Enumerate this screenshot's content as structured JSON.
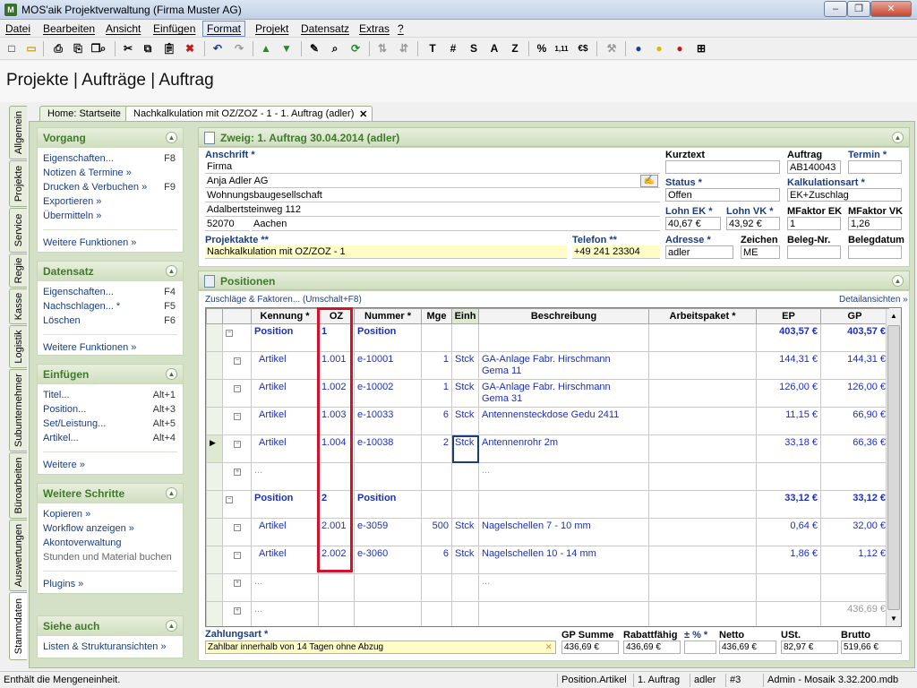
{
  "window": {
    "title": "MOS'aik Projektverwaltung (Firma Muster AG)",
    "min": "–",
    "max": "❐",
    "close": "✕"
  },
  "menu": [
    "Datei",
    "Bearbeiten",
    "Ansicht",
    "Einfügen",
    "Format",
    "Projekt",
    "Datensatz",
    "Extras",
    "?"
  ],
  "toolbar": [
    "new-icon",
    "open-icon",
    "print-icon",
    "print-preview-icon",
    "copy-doc-icon",
    "find-doc-icon",
    "cut-icon",
    "copy-icon",
    "paste-icon",
    "delete-icon",
    "undo-icon",
    "redo-icon",
    "arrow-up-icon",
    "arrow-down-icon",
    "edit-icon",
    "search-icon",
    "refresh-icon",
    "sort-asc-icon",
    "sort-desc-icon",
    "T",
    "#",
    "S",
    "A",
    "Z",
    "%",
    "1,11",
    "€$",
    "tool-icon",
    "user-blue-icon",
    "user-yellow-icon",
    "user-red-icon",
    "layout-icon"
  ],
  "breadcrumb": "Projekte | Aufträge | Auftrag",
  "vtabs": [
    "Allgemein",
    "Projekte",
    "Service",
    "Regie",
    "Kasse",
    "Logistik",
    "Subunternehmer",
    "Büroarbeiten",
    "Auswertungen",
    "Stammdaten"
  ],
  "doctabs": {
    "home": "Home: Startseite",
    "current": "Nachkalkulation mit OZ/ZOZ - 1 - 1. Auftrag (adler)",
    "close": "✕"
  },
  "panels": [
    {
      "title": "Vorgang",
      "items": [
        {
          "label": "Eigenschaften...",
          "key": "F8"
        },
        {
          "label": "Notizen & Termine »",
          "key": ""
        },
        {
          "label": "Drucken & Verbuchen »",
          "key": "F9"
        },
        {
          "label": "Exportieren »",
          "key": ""
        },
        {
          "label": "Übermitteln »",
          "key": ""
        }
      ],
      "more": "Weitere Funktionen »"
    },
    {
      "title": "Datensatz",
      "items": [
        {
          "label": "Eigenschaften...",
          "key": "F4"
        },
        {
          "label": "Nachschlagen... *",
          "key": "F5"
        },
        {
          "label": "Löschen",
          "key": "F6"
        }
      ],
      "more": "Weitere Funktionen »"
    },
    {
      "title": "Einfügen",
      "items": [
        {
          "label": "Titel...",
          "key": "Alt+1"
        },
        {
          "label": "Position...",
          "key": "Alt+3"
        },
        {
          "label": "Set/Leistung...",
          "key": "Alt+5"
        },
        {
          "label": "Artikel...",
          "key": "Alt+4"
        }
      ],
      "more": "Weitere »"
    },
    {
      "title": "Weitere Schritte",
      "items": [
        {
          "label": "Kopieren »",
          "key": ""
        },
        {
          "label": "Workflow anzeigen »",
          "key": ""
        },
        {
          "label": "Akontoverwaltung",
          "key": ""
        },
        {
          "label": "Stunden und Material buchen",
          "key": ""
        }
      ],
      "more": "Plugins »"
    },
    {
      "title": "Siehe auch",
      "items": [
        {
          "label": "Listen & Strukturansichten »",
          "key": ""
        }
      ],
      "more": ""
    }
  ],
  "zweig": {
    "title": "Zweig: 1. Auftrag 30.04.2014 (adler)"
  },
  "address": {
    "anschrift_label": "Anschrift *",
    "lines": [
      "Firma",
      "Anja Adler AG",
      "Wohnungsbaugesellschaft",
      "Adalbertsteinweg 112"
    ],
    "plz": "52070",
    "ort": "Aachen",
    "kurztext_label": "Kurztext",
    "kurztext": "",
    "auftrag_label": "Auftrag",
    "auftrag": "AB140043",
    "termin_label": "Termin *",
    "termin": "",
    "status_label": "Status *",
    "status": "Offen",
    "kalk_label": "Kalkulationsart *",
    "kalk": "EK+Zuschlag",
    "lohnek_label": "Lohn EK *",
    "lohnek": "40,67 €",
    "lohnvk_label": "Lohn VK *",
    "lohnvk": "43,92 €",
    "mfek_label": "MFaktor EK",
    "mfek": "1",
    "mfvk_label": "MFaktor VK",
    "mfvk": "1,26",
    "projektakte_label": "Projektakte **",
    "projektakte": "Nachkalkulation mit OZ/ZOZ - 1",
    "telefon_label": "Telefon **",
    "telefon": "+49 241 23304",
    "adresse_label": "Adresse *",
    "adresse": "adler",
    "zeichen_label": "Zeichen",
    "zeichen": "ME",
    "belegnr_label": "Beleg-Nr.",
    "belegnr": "",
    "belegdatum_label": "Belegdatum",
    "belegdatum": ""
  },
  "positions": {
    "title": "Positionen",
    "zuschlaege": "Zuschläge & Faktoren... (Umschalt+F8)",
    "details": "Detailansichten »",
    "columns": [
      "Kennung *",
      "OZ",
      "Nummer *",
      "Mge",
      "Einh",
      "Beschreibung",
      "Arbeitspaket *",
      "EP",
      "GP"
    ],
    "rows": [
      {
        "kind": "pos",
        "kennung": "Position",
        "oz": "1",
        "nummer": "Position",
        "mge": "",
        "einh": "",
        "beschr": "",
        "ep": "403,57 €",
        "gp": "403,57 €"
      },
      {
        "kind": "art",
        "kennung": "Artikel",
        "oz": "1.001",
        "nummer": "e-10001",
        "mge": "1",
        "einh": "Stck",
        "beschr": "GA-Anlage Fabr. Hirschmann\nGema 11",
        "ep": "144,31 €",
        "gp": "144,31 €"
      },
      {
        "kind": "art",
        "kennung": "Artikel",
        "oz": "1.002",
        "nummer": "e-10002",
        "mge": "1",
        "einh": "Stck",
        "beschr": "GA-Anlage Fabr. Hirschmann\nGema 31",
        "ep": "126,00 €",
        "gp": "126,00 €"
      },
      {
        "kind": "art",
        "kennung": "Artikel",
        "oz": "1.003",
        "nummer": "e-10033",
        "mge": "6",
        "einh": "Stck",
        "beschr": "Antennensteckdose Gedu 2411",
        "ep": "11,15 €",
        "gp": "66,90 €"
      },
      {
        "kind": "art",
        "kennung": "Artikel",
        "oz": "1.004",
        "nummer": "e-10038",
        "mge": "2",
        "einh": "Stck",
        "beschr": "Antennenrohr 2m",
        "ep": "33,18 €",
        "gp": "66,36 €",
        "current": true
      },
      {
        "kind": "empty",
        "kennung": "...",
        "oz": "",
        "nummer": "",
        "mge": "",
        "einh": "",
        "beschr": "...",
        "ep": "",
        "gp": ""
      },
      {
        "kind": "pos",
        "kennung": "Position",
        "oz": "2",
        "nummer": "Position",
        "mge": "",
        "einh": "",
        "beschr": "",
        "ep": "33,12 €",
        "gp": "33,12 €"
      },
      {
        "kind": "art",
        "kennung": "Artikel",
        "oz": "2.001",
        "nummer": "e-3059",
        "mge": "500",
        "einh": "Stck",
        "beschr": "Nagelschellen 7 - 10 mm",
        "ep": "0,64 €",
        "gp": "32,00 €"
      },
      {
        "kind": "art",
        "kennung": "Artikel",
        "oz": "2.002",
        "nummer": "e-3060",
        "mge": "6",
        "einh": "Stck",
        "beschr": "Nagelschellen 10 - 14 mm",
        "ep": "1,86 €",
        "gp": "1,12 €"
      },
      {
        "kind": "empty",
        "kennung": "...",
        "oz": "",
        "nummer": "",
        "mge": "",
        "einh": "",
        "beschr": "...",
        "ep": "",
        "gp": ""
      },
      {
        "kind": "empty",
        "kennung": "...",
        "oz": "",
        "nummer": "",
        "mge": "",
        "einh": "",
        "beschr": "",
        "ep": "",
        "gp": "436,69 €"
      }
    ]
  },
  "totals": {
    "zahlungsart_label": "Zahlungsart *",
    "zahlungsart": "Zahlbar innerhalb von 14 Tagen ohne Abzug",
    "gpsumme_label": "GP Summe",
    "gpsumme": "436,69 €",
    "rabatt_label": "Rabattfähig",
    "rabatt": "436,69 €",
    "proz_label": "± % *",
    "proz": "",
    "netto_label": "Netto",
    "netto": "436,69 €",
    "ust_label": "USt.",
    "ust": "82,97 €",
    "brutto_label": "Brutto",
    "brutto": "519,66 €"
  },
  "status": {
    "message": "Enthält die Mengeneinheit.",
    "context": "Position.Artikel",
    "auftrag": "1. Auftrag",
    "user": "adler",
    "nr": "#3",
    "db": "Admin - Mosaik 3.32.200.mdb"
  },
  "colors": {
    "accent_green": "#3f7a2b",
    "link_blue": "#1a3d80",
    "highlight_red": "#d6102a",
    "pos_blue": "#1b2fbf"
  }
}
